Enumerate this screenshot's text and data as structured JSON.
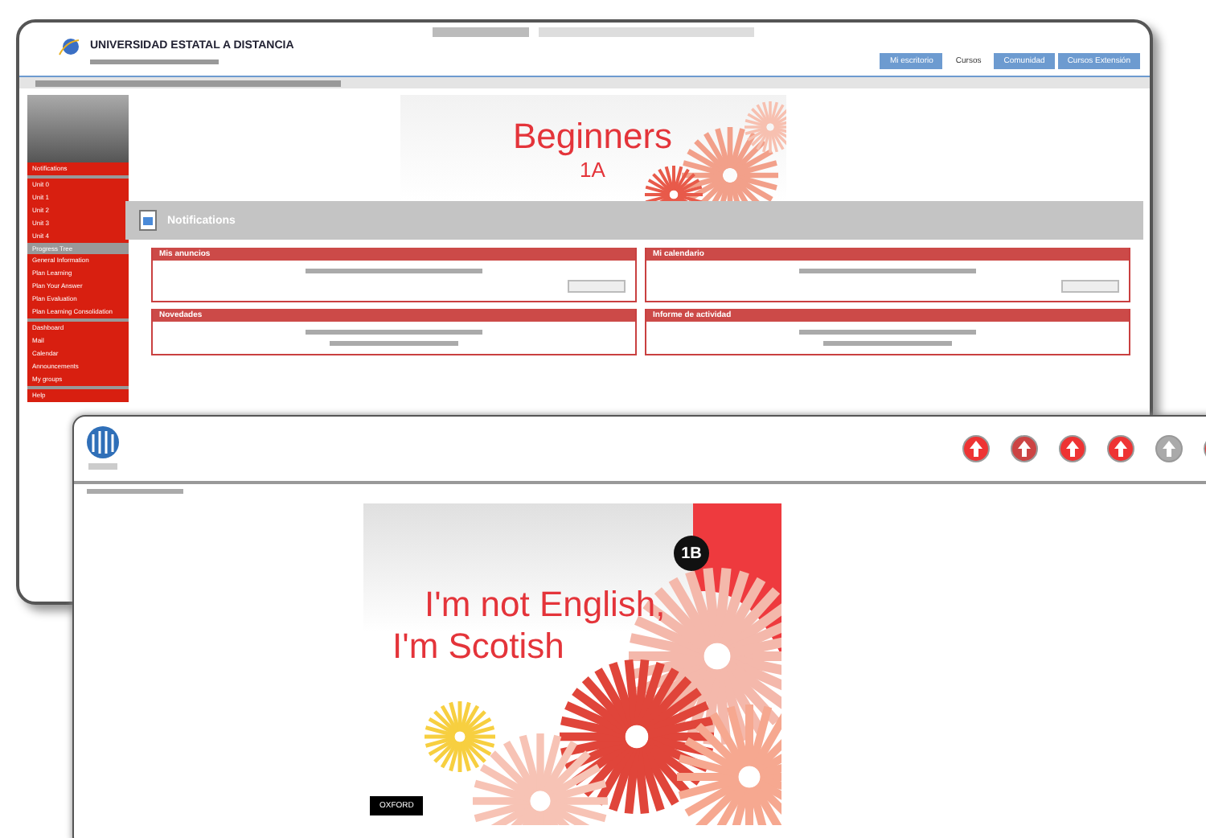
{
  "back_window": {
    "header": {
      "title": "UNIVERSIDAD ESTATAL A DISTANCIA"
    },
    "tabs": [
      {
        "label": "Mi escritorio",
        "selected": false
      },
      {
        "label": "Cursos",
        "selected": true
      },
      {
        "label": "Comunidad",
        "selected": false
      },
      {
        "label": "Cursos Extensión",
        "selected": false
      }
    ],
    "sidebar": {
      "groups": [
        {
          "items": [
            "Notifications"
          ]
        },
        {
          "items": [
            "Unit 0",
            "Unit 1",
            "Unit 2",
            "Unit 3",
            "Unit 4"
          ]
        },
        {
          "heading": "Progress Tree",
          "items": [
            "General Information",
            "Plan Learning",
            "Plan Your Answer",
            "Plan Evaluation",
            "Plan Learning Consolidation"
          ]
        },
        {
          "items": [
            "Dashboard",
            "Mail",
            "Calendar",
            "Announcements",
            "My groups"
          ]
        },
        {
          "items": [
            "Help"
          ]
        }
      ]
    },
    "banner": {
      "title": "Beginners",
      "level": "1A"
    },
    "section_title": "Notifications",
    "panel_columns": [
      [
        {
          "title": "Mis anuncios",
          "kind": "button"
        },
        {
          "title": "Novedades",
          "kind": "list"
        }
      ],
      [
        {
          "title": "Mi calendario",
          "kind": "button"
        },
        {
          "title": "Informe de actividad",
          "kind": "list"
        }
      ]
    ]
  },
  "front_window": {
    "cover": {
      "badge": "1B",
      "title_lines": [
        "I'm not English,",
        "I'm Scotish"
      ],
      "publisher": "OXFORD"
    }
  }
}
